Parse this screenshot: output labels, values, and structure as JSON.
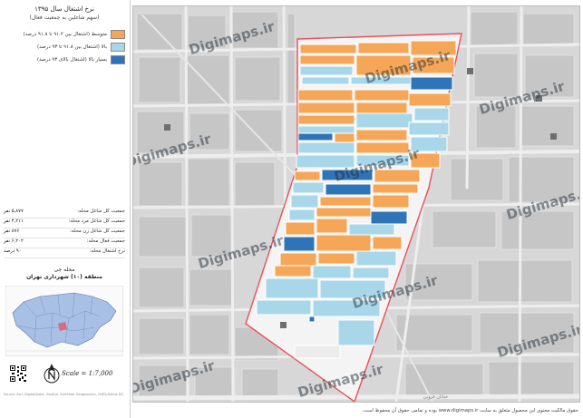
{
  "legend": {
    "title": "نرخ اشتغال سال ۱۳۹۵",
    "subtitle": "(سهم شاغلین به جمعیت فعال)",
    "items": [
      {
        "label": "متوسط (اشتغال بین ۹۱.۲ تا ۹۱.۸ درصد)",
        "color": "#f5a657"
      },
      {
        "label": "بالا (اشتغال بین ۹۱.۸ تا ۹۳ درصد)",
        "color": "#a9d7ea"
      },
      {
        "label": "بسیار بالا (اشتغال بالای ۹۳ درصد)",
        "color": "#2f74b8"
      }
    ]
  },
  "stats": [
    {
      "label": "جمعیت کل شاغل محله:",
      "value": "۵,۸۷۷ نفر"
    },
    {
      "label": "جمعیت کل شاغل مرد محله:",
      "value": "۴,۲۱۱ نفر"
    },
    {
      "label": "جمعیت کل شاغل زن محله:",
      "value": "۸۷۶ نفر"
    },
    {
      "label": "جمعیت فعال محله:",
      "value": "۶,۲۰۲ نفر"
    },
    {
      "label": "نرخ اشتغال محله:",
      "value": "۹۰ درصد"
    }
  ],
  "area": {
    "name": "محله جی",
    "district": "منطقه (۱۰) شهرداری تهران"
  },
  "scale": "Scale = 1:7,000",
  "credit": "Source: Esri, DigitalGlobe, GeoEye, Earthstar Geographics, CNES/Airbus DS, USDA, USGS, AEX, Getmapping, Aerogrid, IGN, IGP, swisstopo",
  "watermark": "Digimaps.ir",
  "footer": "حقوق مالکیت معنوی این محصول متعلق به سایت www.digimaps.ir بوده و تمامی حقوق آن محفوظ است.",
  "map_labels": {
    "road_bottom": "خیابان قزوین"
  },
  "colors": {
    "medium": "#f5a657",
    "high": "#a9d7ea",
    "very_high": "#2f74b8",
    "boundary": "#e8505b",
    "basemap": "#d7d7d7"
  }
}
